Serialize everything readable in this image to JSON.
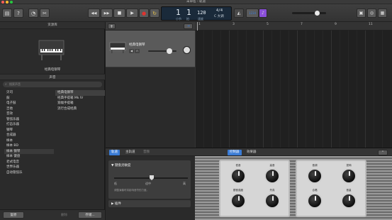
{
  "window": {
    "title": "未命名 - 轨道"
  },
  "toolbar": {
    "position_bar": "1",
    "position_beat": "1",
    "tempo": "120",
    "time_signature": "4/4",
    "key": "C 大调",
    "count_in_label": "1234",
    "tuner_label": "♪",
    "lcd_label_bar": "小节",
    "lcd_label_beat": "拍",
    "lcd_label_tempo": "速度",
    "rewind_icon": "◀◀",
    "forward_icon": "▶▶",
    "stop_icon": "■",
    "play_icon": "▶",
    "record_icon": "●",
    "cycle_icon": "↻"
  },
  "library": {
    "header": "资源库",
    "preset_name": "经典电钢琴",
    "sound_header": "声音",
    "search_placeholder": "搜索声音",
    "categories": [
      {
        "label": "贝司"
      },
      {
        "label": "鼓"
      },
      {
        "label": "电子鼓"
      },
      {
        "label": "吉他"
      },
      {
        "label": "音效"
      },
      {
        "label": "管弦乐器"
      },
      {
        "label": "打击乐器"
      },
      {
        "label": "钢琴"
      },
      {
        "label": "合成器"
      },
      {
        "label": "样本"
      },
      {
        "label": "样本 BD"
      },
      {
        "label": "样本 钢琴"
      },
      {
        "label": "样本 键盘"
      },
      {
        "label": "老式电音"
      },
      {
        "label": "世界乐器"
      },
      {
        "label": "自动管弦乐"
      }
    ],
    "items": [
      {
        "label": "经典电钢琴"
      },
      {
        "label": "经典手提箱 Mk IV"
      },
      {
        "label": "宽幅手提箱"
      },
      {
        "label": "流行合成经典"
      }
    ],
    "revert_label": "复原",
    "delete_label": "删除",
    "save_label": "存储..."
  },
  "tracks": [
    {
      "name": "经典电钢琴"
    }
  ],
  "ruler": {
    "bars": [
      "1",
      "3",
      "5",
      "7",
      "9",
      "11"
    ]
  },
  "editor": {
    "tabs": [
      "轨道",
      "主轨道",
      "音频"
    ],
    "right_tabs": [
      "控制器",
      "效果器"
    ],
    "section_keyboard": "键盘灵敏度",
    "slider_low": "低",
    "slider_mid": "适中",
    "slider_high": "高",
    "hint": "调整演奏时将影响音符的力度。",
    "plugins_label": "插件"
  },
  "amp": {
    "left_knobs": [
      "低音",
      "高音",
      "颤音强度",
      "失真"
    ],
    "right_knobs": [
      "音调",
      "混响",
      "合唱",
      "音量"
    ]
  },
  "colors": {
    "accent": "#3a7bd5",
    "record": "#e0332f",
    "cycle": "#e8c34a",
    "tuner": "#8a4fd8",
    "track_bg": "#5a5a5a"
  }
}
